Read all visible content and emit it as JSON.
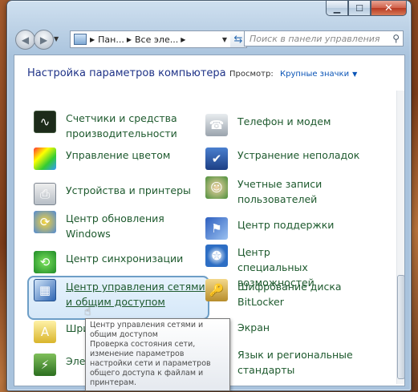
{
  "address": {
    "crumbs": [
      "Пан...",
      "Все эле..."
    ],
    "search_placeholder": "Поиск в панели управления"
  },
  "content": {
    "heading": "Настройка параметров компьютера",
    "view_label": "Просмотр:",
    "view_value": "Крупные значки"
  },
  "items_left": [
    {
      "label": "Счетчики и средства производительности",
      "icon": "performance-icon"
    },
    {
      "label": "Управление цветом",
      "icon": "color-management-icon"
    },
    {
      "label": "Устройства и принтеры",
      "icon": "printer-icon"
    },
    {
      "label": "Центр обновления Windows",
      "icon": "windows-update-icon"
    },
    {
      "label": "Центр синхронизации",
      "icon": "sync-center-icon"
    },
    {
      "label": "Центр управления сетями и общим доступом",
      "icon": "network-center-icon"
    },
    {
      "label": "Шриф",
      "icon": "fonts-icon"
    },
    {
      "label": "Электр",
      "icon": "power-options-icon"
    }
  ],
  "items_right": [
    {
      "label": "Телефон и модем",
      "icon": "phone-modem-icon"
    },
    {
      "label": "Устранение неполадок",
      "icon": "troubleshooting-icon"
    },
    {
      "label": "Учетные записи пользователей",
      "icon": "user-accounts-icon"
    },
    {
      "label": "Центр поддержки",
      "icon": "action-center-icon"
    },
    {
      "label": "Центр специальных возможностей",
      "icon": "ease-of-access-icon"
    },
    {
      "label": "Шифрование диска BitLocker",
      "icon": "bitlocker-icon"
    },
    {
      "label": "Экран",
      "icon": "display-icon"
    },
    {
      "label": "Язык и региональные стандарты",
      "icon": "region-language-icon"
    }
  ],
  "tooltip": {
    "title": "Центр управления сетями и общим доступом",
    "description": "Проверка состояния сети, изменение параметров настройки сети и параметров общего доступа к файлам и принтерам."
  }
}
